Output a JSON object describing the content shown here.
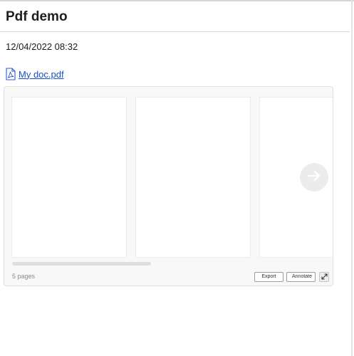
{
  "header": {
    "title": "Pdf demo"
  },
  "timestamp": "12/04/2022 08:32",
  "attachment": {
    "file_name": "My doc.pdf",
    "icon": "pdf-file-icon"
  },
  "viewer": {
    "page_count_label": "5 pages",
    "export_label": "Export",
    "annotate_label": "Annotate",
    "next_icon": "arrow-right-icon",
    "expand_icon": "expand-icon"
  },
  "colors": {
    "link": "#1a4fc9",
    "panel": "#f8f8f8",
    "pdf_icon": "#2d5bd0"
  }
}
